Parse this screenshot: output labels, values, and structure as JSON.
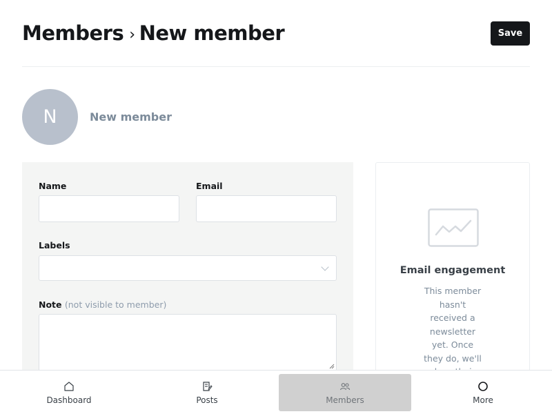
{
  "header": {
    "breadcrumb_parent": "Members",
    "breadcrumb_separator": "›",
    "breadcrumb_current": "New member",
    "save_label": "Save"
  },
  "member": {
    "avatar_initial": "N",
    "display_name": "New member"
  },
  "form": {
    "name_label": "Name",
    "name_value": "",
    "email_label": "Email",
    "email_value": "",
    "labels_label": "Labels",
    "labels_value": "",
    "note_label": "Note",
    "note_hint": "(not visible to member)",
    "note_value": ""
  },
  "engagement": {
    "icon": "chart-icon",
    "title": "Email engagement",
    "description": "This member hasn't received a newsletter yet. Once they do, we'll show their"
  },
  "bottom_nav": {
    "items": [
      {
        "label": "Dashboard",
        "icon": "home-icon",
        "active": false
      },
      {
        "label": "Posts",
        "icon": "posts-icon",
        "active": false
      },
      {
        "label": "Members",
        "icon": "members-icon",
        "active": true
      },
      {
        "label": "More",
        "icon": "more-icon",
        "active": false
      }
    ]
  },
  "colors": {
    "primary_button": "#15171a",
    "avatar_bg": "#b8c0cc",
    "form_bg": "#f4f5f4",
    "active_nav_bg": "#d0d0d0"
  }
}
